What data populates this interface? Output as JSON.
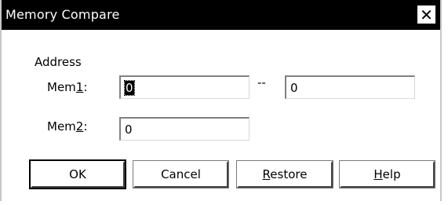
{
  "window": {
    "title": "Memory Compare",
    "close_glyph": "✕"
  },
  "address_group": {
    "label": "Address",
    "mem1": {
      "label_prefix": "Mem",
      "label_accel": "1",
      "label_suffix": ":",
      "start_value": "0",
      "separator": "--",
      "end_value": "0"
    },
    "mem2": {
      "label_prefix": "Mem",
      "label_accel": "2",
      "label_suffix": ":",
      "value": "0"
    }
  },
  "buttons": {
    "ok": "OK",
    "cancel": "Cancel",
    "restore_accel": "R",
    "restore_rest": "estore",
    "help_accel": "H",
    "help_rest": "elp"
  },
  "icons": {
    "close": "close-icon"
  }
}
